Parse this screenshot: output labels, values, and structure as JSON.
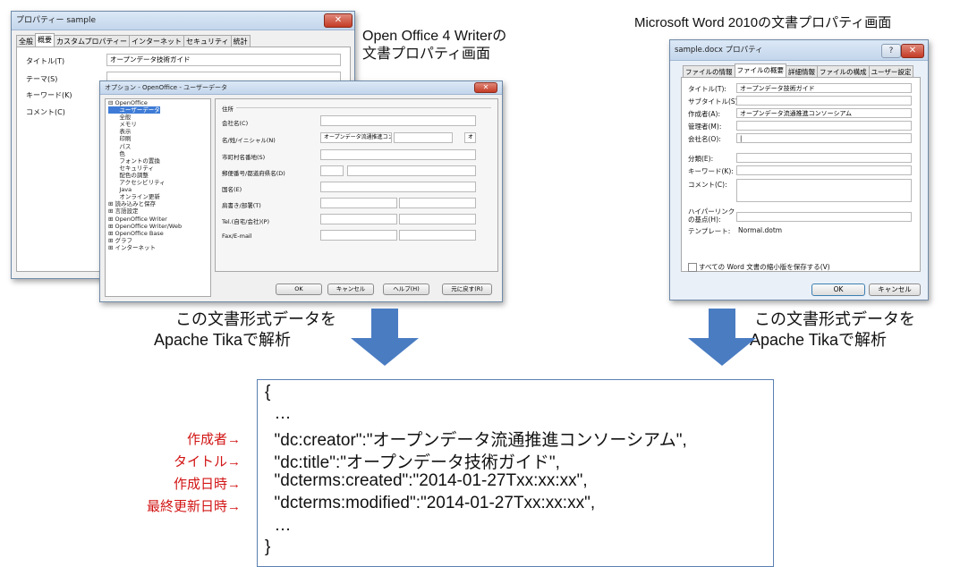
{
  "oo_props_window": {
    "title": "プロパティー sample",
    "tabs": [
      "全般",
      "概要",
      "カスタムプロパティー",
      "インターネット",
      "セキュリティ",
      "統計"
    ],
    "active_tab": "概要",
    "fields": [
      {
        "label": "タイトル(T)",
        "value": "オープンデータ技術ガイド"
      },
      {
        "label": "テーマ(S)",
        "value": ""
      },
      {
        "label": "キーワード(K)",
        "value": ""
      },
      {
        "label": "コメント(C)",
        "value": ""
      }
    ]
  },
  "oo_options_window": {
    "title": "オプション - OpenOffice - ユーザーデータ",
    "tree": [
      "⊟ OpenOffice",
      "      ユーザーデータ",
      "      全般",
      "      メモリ",
      "      表示",
      "      印刷",
      "      パス",
      "      色",
      "      フォントの置換",
      "      セキュリティ",
      "      配色の調整",
      "      アクセシビリティ",
      "      Java",
      "      オンライン更新",
      "⊞ 読み込みと保存",
      "⊞ 言語設定",
      "⊞ OpenOffice Writer",
      "⊞ OpenOffice Writer/Web",
      "⊞ OpenOffice Base",
      "⊞ グラフ",
      "⊞ インターネット"
    ],
    "section_label": "住所",
    "fields": [
      {
        "label": "会社名(C)",
        "value": ""
      },
      {
        "label": "名/姓/イニシャル(N)",
        "value": "オープンデータ流通推進コン:",
        "extra": "オ"
      },
      {
        "label": "市町村名番地(S)",
        "value": ""
      },
      {
        "label": "郵便番号/都道府県名(D)",
        "value": ""
      },
      {
        "label": "国名(E)",
        "value": ""
      },
      {
        "label": "肩書き/部署(T)",
        "value": ""
      },
      {
        "label": "Tel.(自宅/会社)(P)",
        "value": ""
      },
      {
        "label": "Fax/E-mail",
        "value": ""
      }
    ],
    "buttons": {
      "ok": "OK",
      "cancel": "キャンセル",
      "help": "ヘルプ(H)",
      "reset": "元に戻す(R)"
    }
  },
  "word_window": {
    "title": "sample.docx プロパティ",
    "help_glyph": "?",
    "tabs": [
      "ファイルの情報",
      "ファイルの概要",
      "詳細情報",
      "ファイルの構成",
      "ユーザー設定"
    ],
    "active_tab": "ファイルの概要",
    "fields": [
      {
        "label": "タイトル(T):",
        "value": "オープンデータ技術ガイド"
      },
      {
        "label": "サブタイトル(S):",
        "value": ""
      },
      {
        "label": "作成者(A):",
        "value": "オープンデータ流通推進コンソーシアム"
      },
      {
        "label": "管理者(M):",
        "value": ""
      },
      {
        "label": "会社名(O):",
        "value": "|"
      },
      {
        "label": "分類(E):",
        "value": ""
      },
      {
        "label": "キーワード(K):",
        "value": ""
      },
      {
        "label": "コメント(C):",
        "value": ""
      }
    ],
    "hyperlink_label_1": "ハイパーリンク",
    "hyperlink_label_2": "の基点(H):",
    "template_label": "テンプレート:",
    "template_value": "Normal.dotm",
    "checkbox_label": "すべての Word 文書の縮小版を保存する(V)",
    "buttons": {
      "ok": "OK",
      "cancel": "キャンセル"
    }
  },
  "captions": {
    "oo_line1": "Open Office 4 Writerの",
    "oo_line2": "文書プロパティ画面",
    "word_line1": "Microsoft Word 2010の文書プロパティ画面",
    "left_parse_1": "この文書形式データを",
    "left_parse_2": "Apache Tikaで解析",
    "right_parse_1": "この文書形式データを",
    "right_parse_2": "Apache Tikaで解析"
  },
  "json_output": {
    "lines": [
      "{",
      "  …",
      "  \"dc:creator\":\"オープンデータ流通推進コンソーシアム\",",
      "  \"dc:title\":\"オープンデータ技術ガイド\",",
      "  \"dcterms:created\":\"2014-01-27Txx:xx:xx\",",
      "  \"dcterms:modified\":\"2014-01-27Txx:xx:xx\",",
      "  …",
      "}"
    ],
    "annotations": [
      "作成者→",
      "タイトル→",
      "作成日時→",
      "最終更新日時→"
    ]
  },
  "colors": {
    "arrow": "#4a7cc2",
    "annotation": "#d21414",
    "box_border": "#5b7fb2"
  }
}
